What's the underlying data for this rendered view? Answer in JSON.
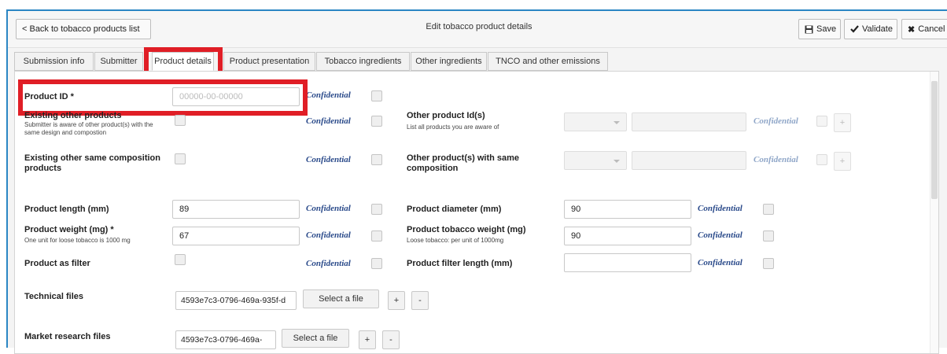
{
  "header": {
    "back_label": "< Back to tobacco products list",
    "title": "Edit tobacco product details",
    "save_label": "Save",
    "validate_label": "Validate",
    "cancel_label": "Cancel"
  },
  "tabs": [
    {
      "label": "Submission info"
    },
    {
      "label": "Submitter"
    },
    {
      "label": "Product details"
    },
    {
      "label": "Product presentation"
    },
    {
      "label": "Tobacco ingredients"
    },
    {
      "label": "Other ingredients"
    },
    {
      "label": "TNCO and other emissions"
    }
  ],
  "form": {
    "confidential": "Confidential",
    "product_id": {
      "label": "Product ID *",
      "placeholder": "00000-00-00000"
    },
    "existing_other": {
      "label": "Existing other products",
      "sub": "Submitter is aware of other product(s) with the same design and compostion"
    },
    "other_ids": {
      "label": "Other product Id(s)",
      "sub": "List all products you are aware of"
    },
    "existing_same": {
      "label": "Existing other same composition products"
    },
    "same_comp": {
      "label": "Other product(s) with same composition"
    },
    "length": {
      "label": "Product length (mm)",
      "value": "89"
    },
    "diameter": {
      "label": "Product diameter (mm)",
      "value": "90"
    },
    "weight": {
      "label": "Product weight (mg) *",
      "sub": "One unit for loose tobacco is 1000 mg",
      "value": "67"
    },
    "tob_weight": {
      "label": "Product tobacco weight (mg)",
      "sub": "Loose tobacco: per unit of 1000mg",
      "value": "90"
    },
    "as_filter": {
      "label": "Product as filter"
    },
    "filter_length": {
      "label": "Product filter length (mm)",
      "value": ""
    },
    "technical": {
      "label": "Technical files",
      "value": "4593e7c3-0796-469a-935f-d",
      "select_label": "Select a file"
    },
    "market": {
      "label": "Market research files",
      "value": "4593e7c3-0796-469a-",
      "select_label": "Select a file"
    },
    "plus": "+",
    "minus": "-"
  }
}
